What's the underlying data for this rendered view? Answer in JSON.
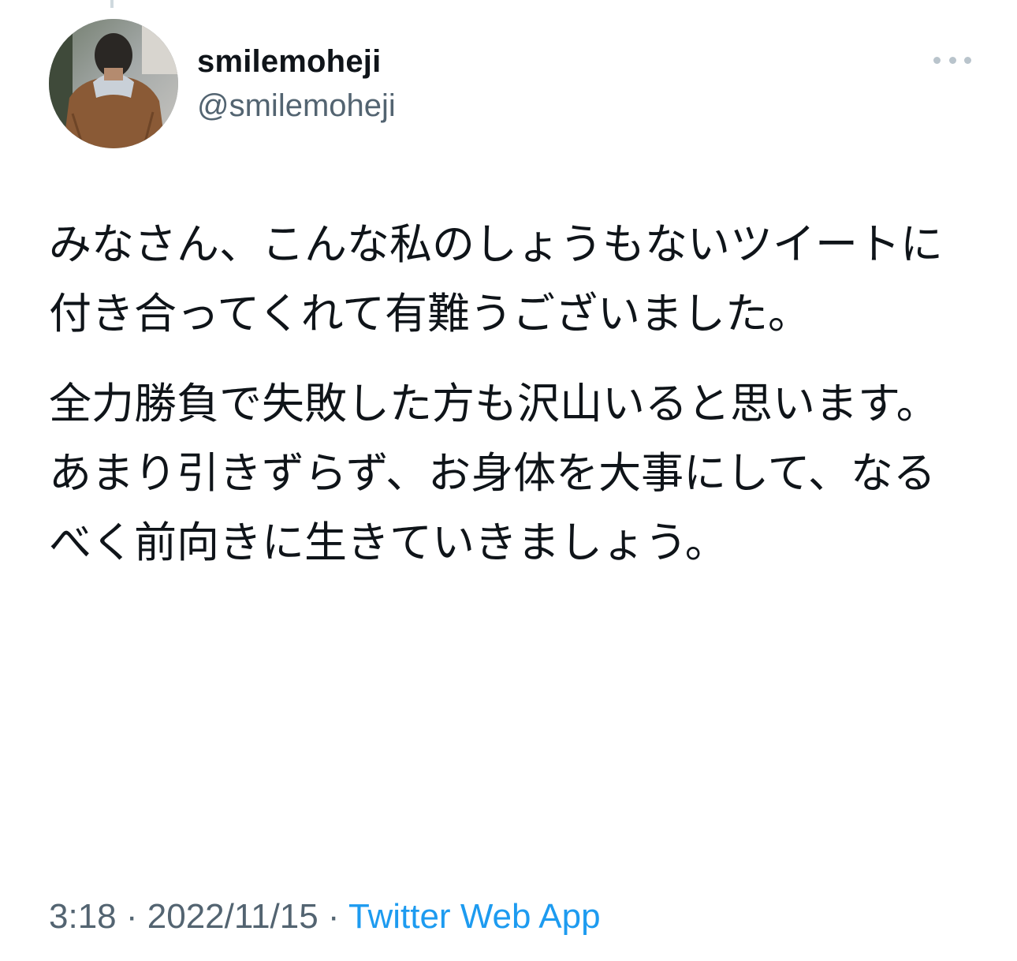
{
  "tweet": {
    "author": {
      "display_name": "smilemoheji",
      "handle": "@smilemoheji",
      "avatar_icon": "profile-photo"
    },
    "more_icon": "more-horizontal-icon",
    "paragraphs": [
      "みなさん、こんな私のしょうもないツイートに付き合ってくれて有難うございました。",
      "全力勝負で失敗した方も沢山いると思います。",
      "あまり引きずらず、お身体を大事にして、なるべく前向きに生きていきましょう。"
    ],
    "meta": {
      "time": "3:18",
      "separator": " · ",
      "date": "2022/11/15",
      "source": "Twitter Web App"
    }
  },
  "colors": {
    "text": "#0f1419",
    "secondary": "#536471",
    "link": "#1d9bf0",
    "more_dots": "#b9c4cc"
  }
}
